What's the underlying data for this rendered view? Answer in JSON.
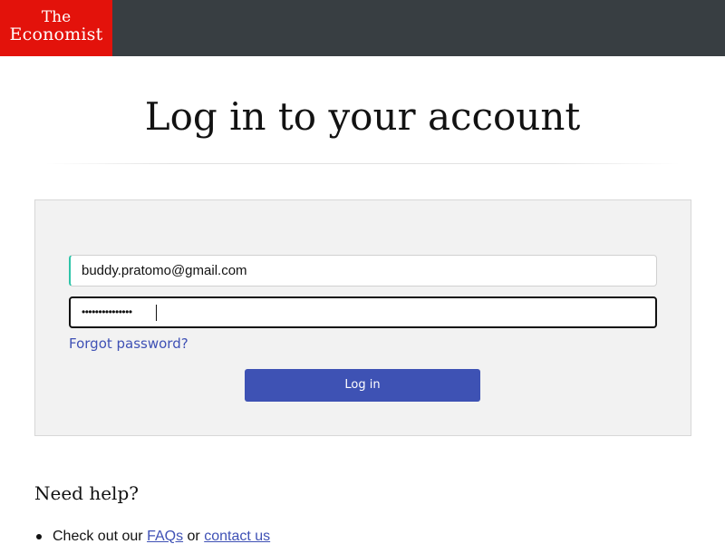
{
  "header": {
    "logo_line1": "The",
    "logo_line2": "Economist",
    "bar_color": "#383e42",
    "logo_color": "#e3120b"
  },
  "page": {
    "title": "Log in to your account"
  },
  "login_form": {
    "email_value": "buddy.pratomo@gmail.com",
    "password_masked": "•••••••••••••••",
    "forgot_password_label": "Forgot password?",
    "login_button_label": "Log in",
    "accent_color": "#3e52b4"
  },
  "help": {
    "heading": "Need help?",
    "item_prefix": "Check out our",
    "faqs_link": "FAQs",
    "joiner": "or",
    "contact_link": "contact us"
  }
}
